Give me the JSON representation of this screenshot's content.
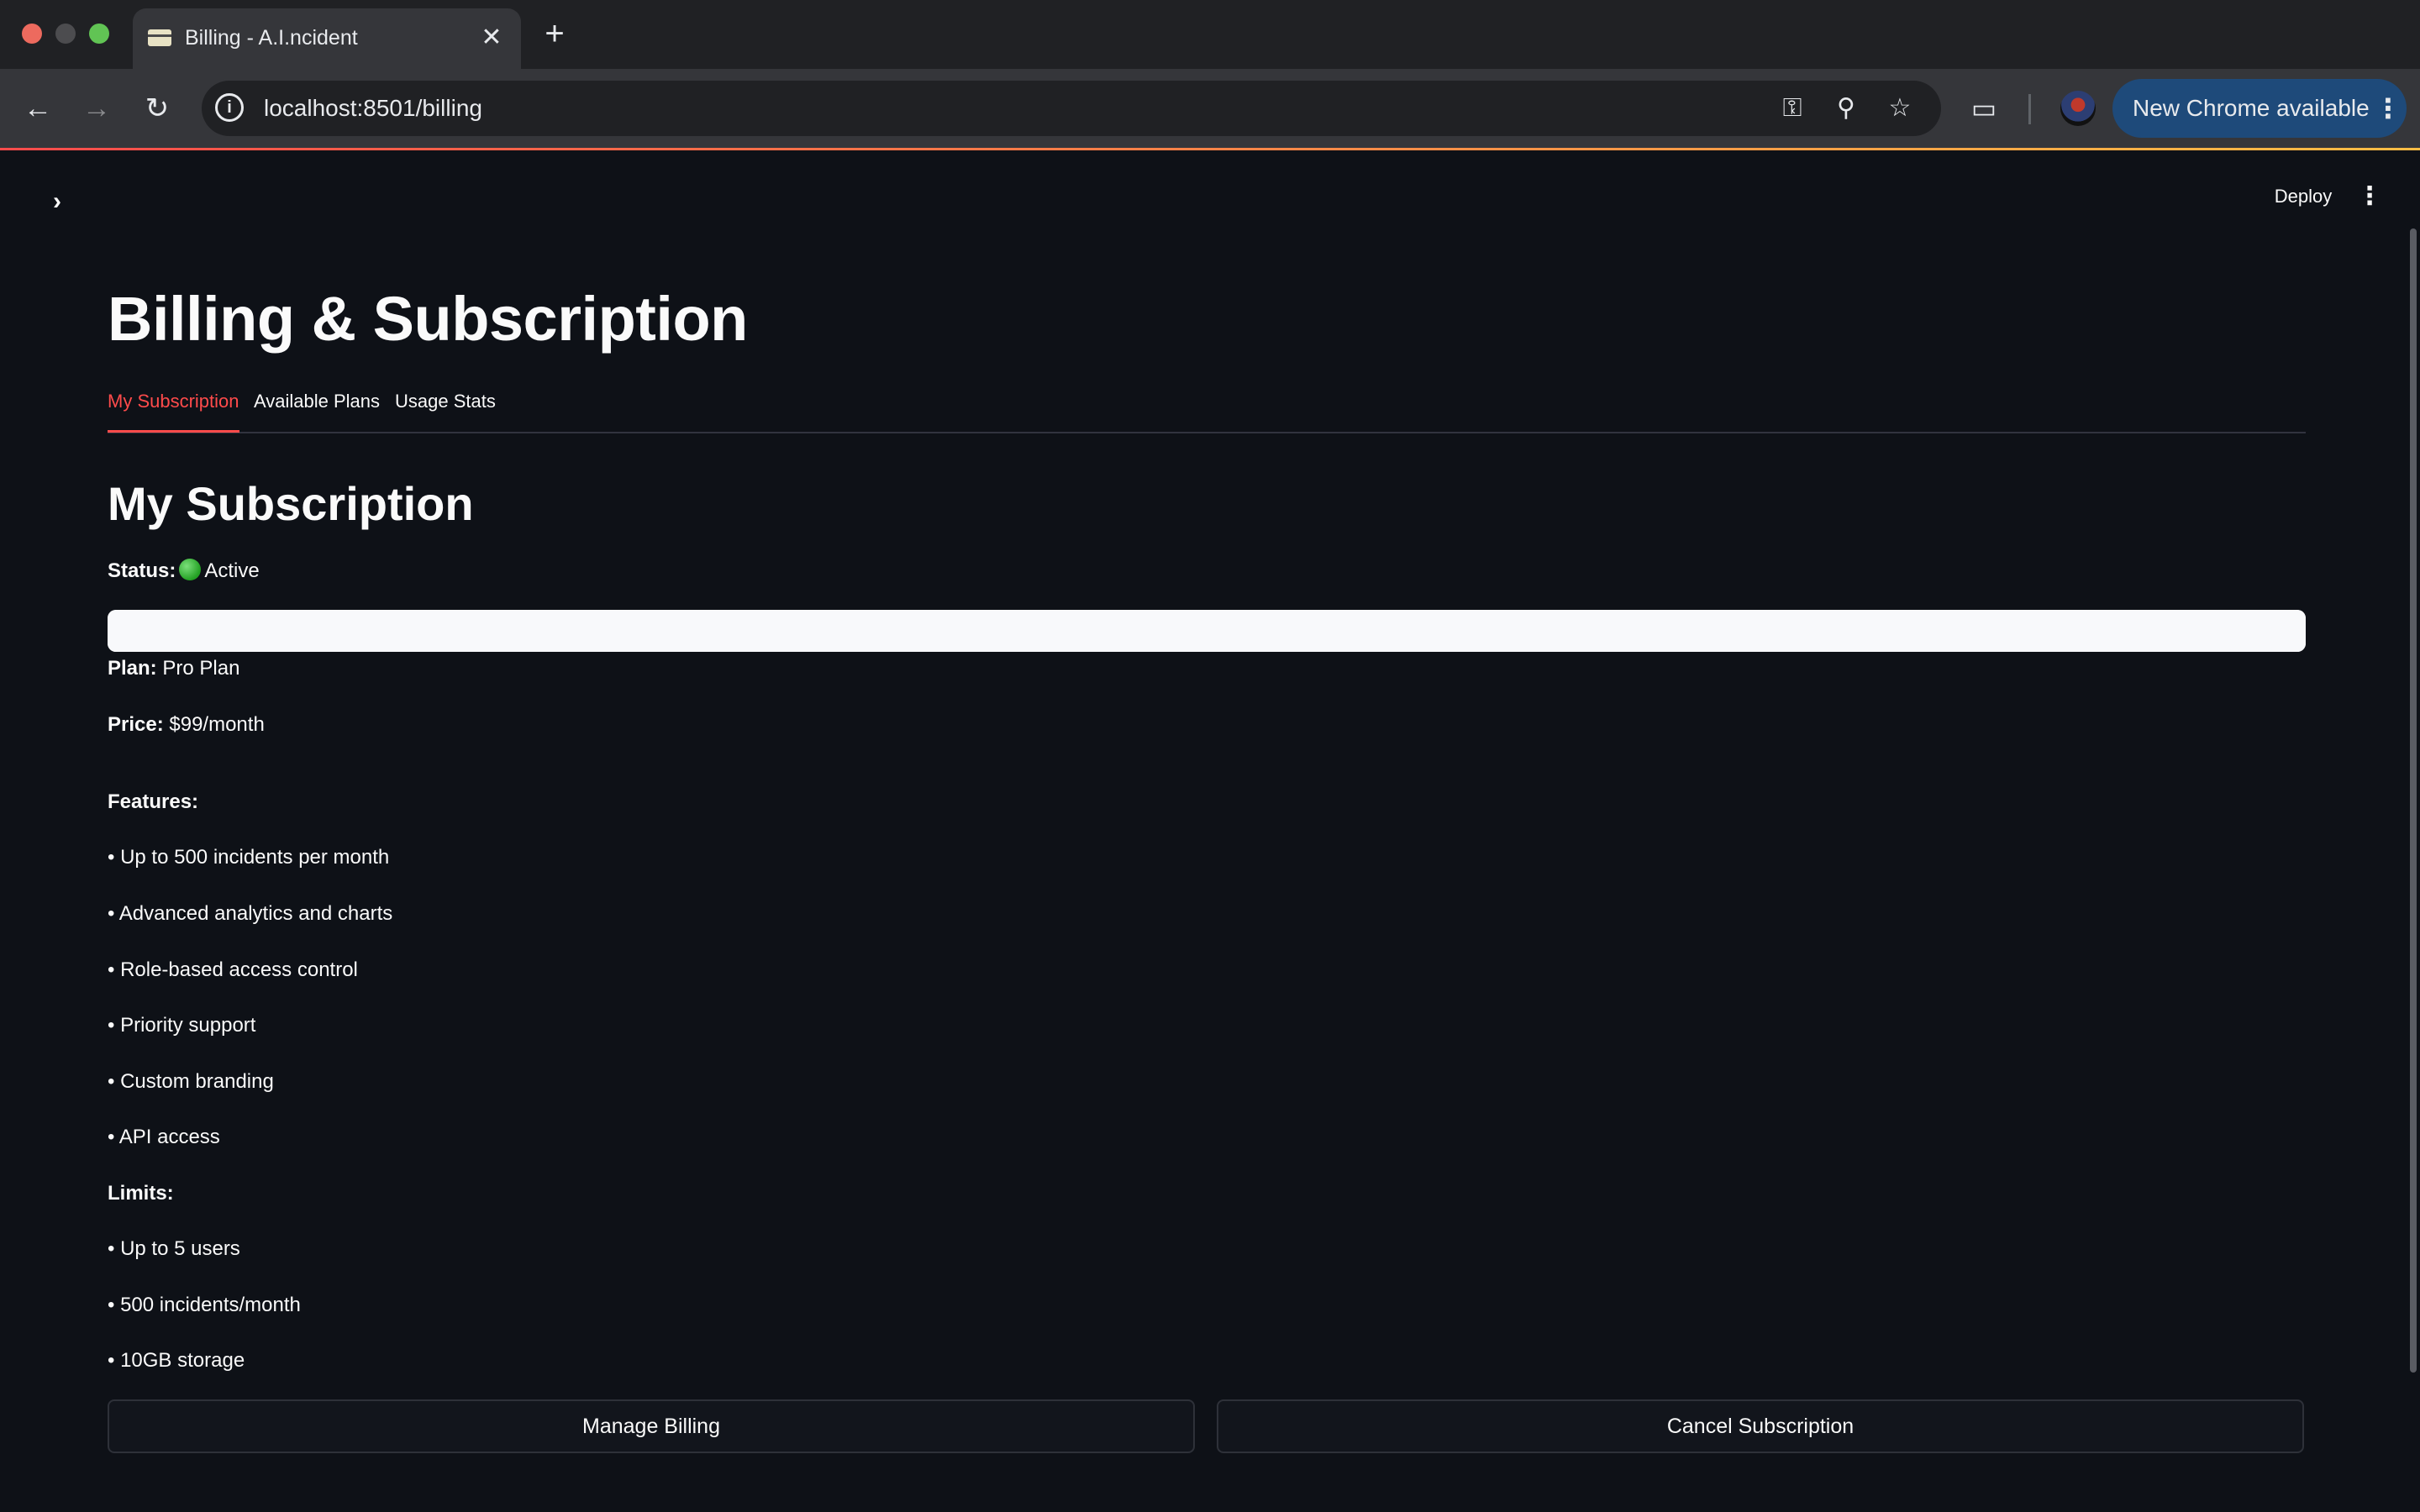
{
  "browser": {
    "tab_title": "Billing - A.I.ncident",
    "url": "localhost:8501/billing",
    "update_label": "New Chrome available",
    "icons": [
      "back-arrow-icon",
      "forward-arrow-icon",
      "reload-icon",
      "site-info-icon",
      "key-icon",
      "zoom-icon",
      "star-icon",
      "cast-search-icon",
      "profile-avatar",
      "menu-dots-icon"
    ]
  },
  "app": {
    "deploy_label": "Deploy",
    "page_title": "Billing & Subscription",
    "tabs": [
      {
        "label": "My Subscription",
        "active": true
      },
      {
        "label": "Available Plans",
        "active": false
      },
      {
        "label": "Usage Stats",
        "active": false
      }
    ],
    "accent_color": "#ff4b4b"
  },
  "subscription": {
    "heading": "My Subscription",
    "status_label": "Status:",
    "status_value": "Active",
    "status_color": "#23a023",
    "progress_fraction": 1.0,
    "plan_label": "Plan:",
    "plan_value": "Pro Plan",
    "price_label": "Price:",
    "price_value": "$99/month",
    "features_label": "Features:",
    "features": [
      "• Up to 500 incidents per month",
      "• Advanced analytics and charts",
      "• Role-based access control",
      "• Priority support",
      "• Custom branding",
      "• API access"
    ],
    "limits_label": "Limits:",
    "limits": [
      "• Up to 5 users",
      "• 500 incidents/month",
      "• 10GB storage"
    ]
  },
  "actions": {
    "manage_label": "Manage Billing",
    "cancel_label": "Cancel Subscription"
  }
}
